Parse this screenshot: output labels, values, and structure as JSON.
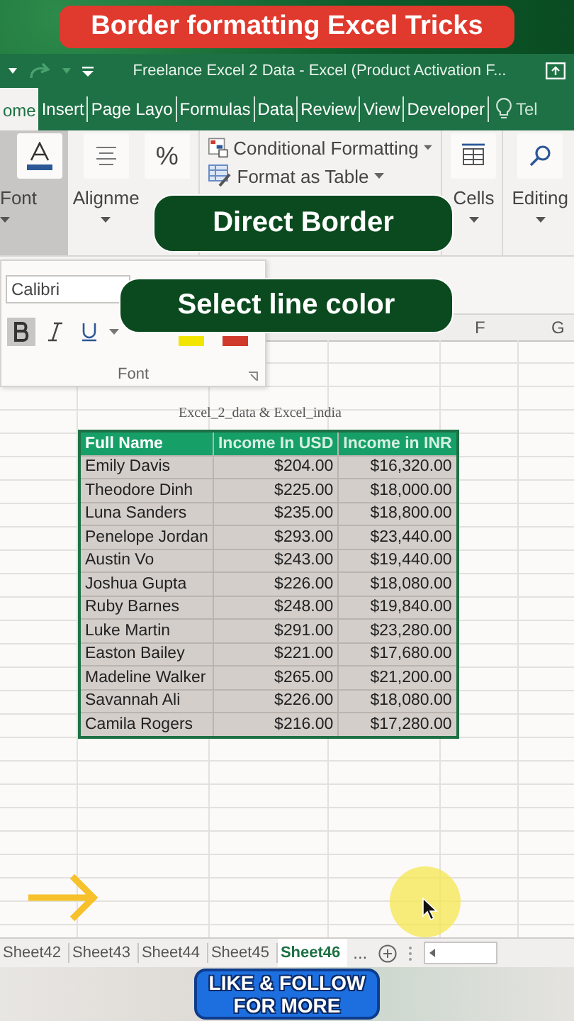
{
  "video_title": "Border formatting Excel Tricks",
  "window": {
    "title": "Freelance Excel 2 Data - Excel (Product Activation F..."
  },
  "tabs": [
    {
      "label": "ome",
      "selected": true
    },
    {
      "label": "Insert",
      "selected": false
    },
    {
      "label": "Page Layo",
      "selected": false
    },
    {
      "label": "Formulas",
      "selected": false
    },
    {
      "label": "Data",
      "selected": false
    },
    {
      "label": "Review",
      "selected": false
    },
    {
      "label": "View",
      "selected": false
    },
    {
      "label": "Developer",
      "selected": false
    }
  ],
  "tell_me": "Tel",
  "ribbon": {
    "groups": [
      {
        "label": "Font",
        "selected": true
      },
      {
        "label": "Alignme",
        "selected": false
      }
    ],
    "number_symbol": "%",
    "styles": [
      "Conditional Formatting",
      "Format as Table"
    ],
    "cells": "Cells",
    "editing": "Editing"
  },
  "captions": [
    "Direct Border",
    "Select line color"
  ],
  "font_panel": {
    "font_name": "Calibri",
    "bold": true,
    "italic": false,
    "underline": false,
    "swatches": [
      {
        "color": "#f2e500"
      },
      {
        "color": "#d03a2c"
      }
    ],
    "group_label": "Font"
  },
  "sheet": {
    "column_headers": [
      "F",
      "G"
    ],
    "table_title": "Excel_2_data & Excel_india",
    "columns": [
      "Full Name",
      "Income In USD",
      "Income in INR"
    ],
    "rows": [
      [
        "Emily Davis",
        "$204.00",
        "$16,320.00"
      ],
      [
        "Theodore Dinh",
        "$225.00",
        "$18,000.00"
      ],
      [
        "Luna Sanders",
        "$235.00",
        "$18,800.00"
      ],
      [
        "Penelope Jordan",
        "$293.00",
        "$23,440.00"
      ],
      [
        "Austin Vo",
        "$243.00",
        "$19,440.00"
      ],
      [
        "Joshua Gupta",
        "$226.00",
        "$18,080.00"
      ],
      [
        "Ruby Barnes",
        "$248.00",
        "$19,840.00"
      ],
      [
        "Luke Martin",
        "$291.00",
        "$23,280.00"
      ],
      [
        "Easton Bailey",
        "$221.00",
        "$17,680.00"
      ],
      [
        "Madeline Walker",
        "$265.00",
        "$21,200.00"
      ],
      [
        "Savannah Ali",
        "$226.00",
        "$18,080.00"
      ],
      [
        "Camila Rogers",
        "$216.00",
        "$17,280.00"
      ]
    ]
  },
  "sheet_tabs": [
    {
      "label": "Sheet42",
      "selected": false
    },
    {
      "label": "Sheet43",
      "selected": false
    },
    {
      "label": "Sheet44",
      "selected": false
    },
    {
      "label": "Sheet45",
      "selected": false
    },
    {
      "label": "Sheet46",
      "selected": true
    }
  ],
  "more_sheets": "...",
  "sticker": [
    "LIKE & FOLLOW",
    "FOR MORE"
  ]
}
